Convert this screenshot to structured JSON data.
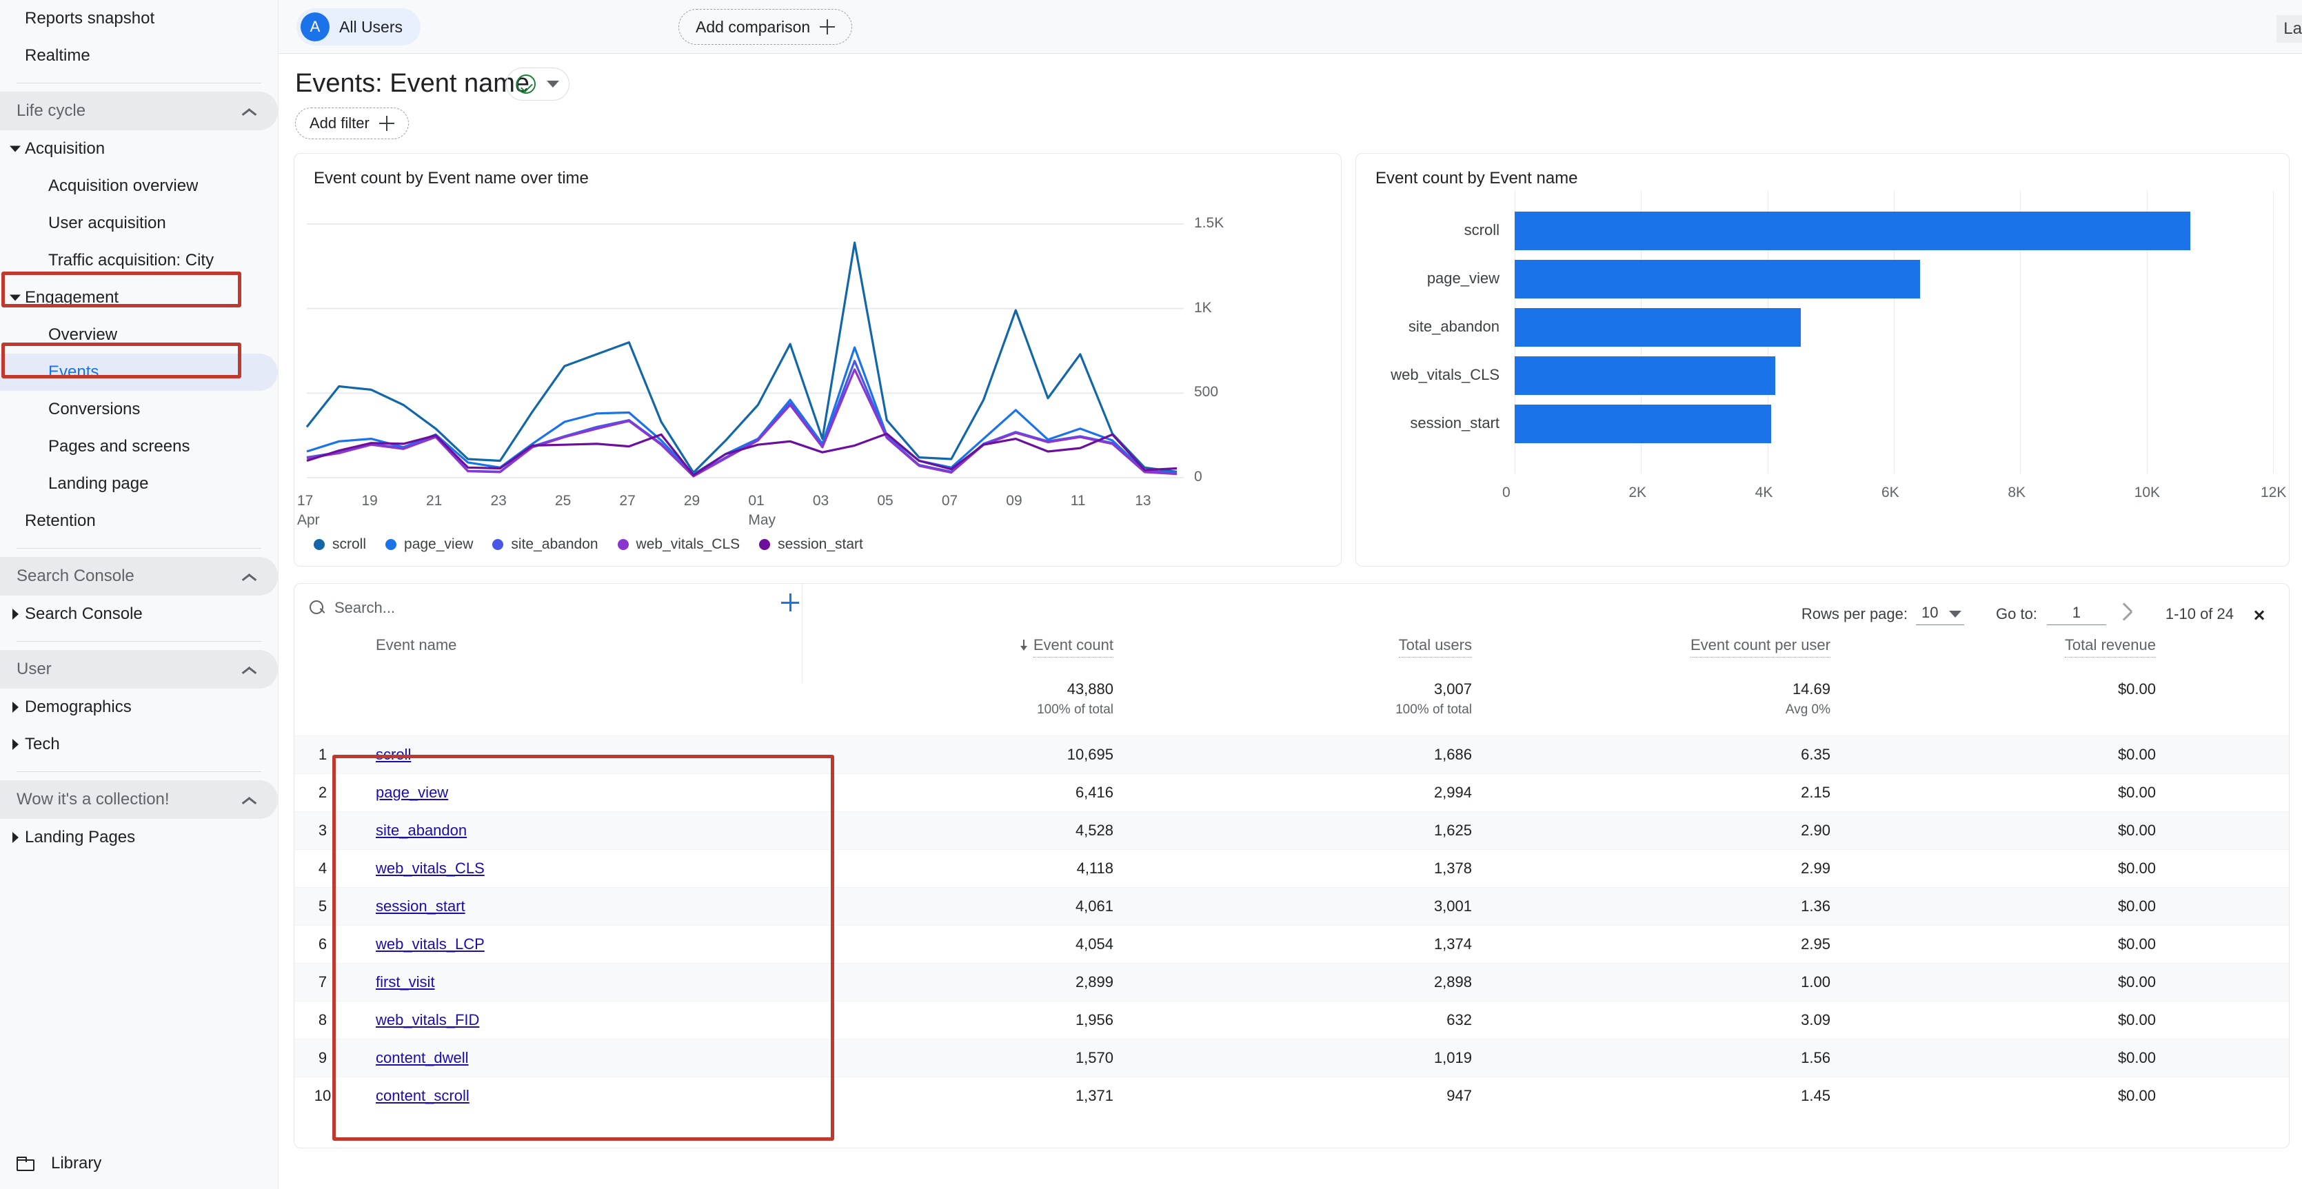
{
  "sidebar": {
    "top_items": [
      {
        "label": "Reports snapshot"
      },
      {
        "label": "Realtime"
      }
    ],
    "sections": [
      {
        "title": "Life cycle",
        "items": [
          {
            "label": "Acquisition",
            "level": 1,
            "caret": "down"
          },
          {
            "label": "Acquisition overview",
            "level": 2
          },
          {
            "label": "User acquisition",
            "level": 2
          },
          {
            "label": "Traffic acquisition: City",
            "level": 2
          },
          {
            "label": "Engagement",
            "level": 1,
            "caret": "down",
            "highlighted": true
          },
          {
            "label": "Overview",
            "level": 2
          },
          {
            "label": "Events",
            "level": 2,
            "selected": true
          },
          {
            "label": "Conversions",
            "level": 2
          },
          {
            "label": "Pages and screens",
            "level": 2
          },
          {
            "label": "Landing page",
            "level": 2
          },
          {
            "label": "Retention",
            "level": 1
          }
        ]
      },
      {
        "title": "Search Console",
        "items": [
          {
            "label": "Search Console",
            "level": 1,
            "caret": "right"
          }
        ]
      },
      {
        "title": "User",
        "items": [
          {
            "label": "Demographics",
            "level": 1,
            "caret": "right"
          },
          {
            "label": "Tech",
            "level": 1,
            "caret": "right"
          }
        ]
      },
      {
        "title": "Wow it's a collection!",
        "items": [
          {
            "label": "Landing Pages",
            "level": 1,
            "caret": "right"
          }
        ]
      }
    ],
    "library_label": "Library",
    "library_icon": "folder-icon"
  },
  "topbar": {
    "audience_initial": "A",
    "audience_label": "All Users",
    "add_comparison_label": "Add comparison",
    "date_range_clipped": "La"
  },
  "header": {
    "title": "Events: Event name",
    "add_filter_label": "Add filter",
    "status_icon": "check-circle-icon"
  },
  "line_card": {
    "title": "Event count by Event name over time"
  },
  "bar_card": {
    "title": "Event count by Event name"
  },
  "table": {
    "search_placeholder": "Search...",
    "rows_per_page_label": "Rows per page:",
    "rows_per_page_value": "10",
    "goto_label": "Go to:",
    "goto_value": "1",
    "page_range": "1-10 of 24",
    "columns": [
      "Event name",
      "Event count",
      "Total users",
      "Event count per user",
      "Total revenue"
    ],
    "sorted_column": "Event count",
    "totals": {
      "event_count": "43,880",
      "event_count_sub": "100% of total",
      "total_users": "3,007",
      "total_users_sub": "100% of total",
      "event_count_per_user": "14.69",
      "event_count_per_user_sub": "Avg 0%",
      "total_revenue": "$0.00",
      "total_revenue_sub": ""
    },
    "rows": [
      {
        "rank": "1",
        "name": "scroll",
        "event_count": "10,695",
        "total_users": "1,686",
        "per_user": "6.35",
        "revenue": "$0.00"
      },
      {
        "rank": "2",
        "name": "page_view",
        "event_count": "6,416",
        "total_users": "2,994",
        "per_user": "2.15",
        "revenue": "$0.00"
      },
      {
        "rank": "3",
        "name": "site_abandon",
        "event_count": "4,528",
        "total_users": "1,625",
        "per_user": "2.90",
        "revenue": "$0.00"
      },
      {
        "rank": "4",
        "name": "web_vitals_CLS",
        "event_count": "4,118",
        "total_users": "1,378",
        "per_user": "2.99",
        "revenue": "$0.00"
      },
      {
        "rank": "5",
        "name": "session_start",
        "event_count": "4,061",
        "total_users": "3,001",
        "per_user": "1.36",
        "revenue": "$0.00"
      },
      {
        "rank": "6",
        "name": "web_vitals_LCP",
        "event_count": "4,054",
        "total_users": "1,374",
        "per_user": "2.95",
        "revenue": "$0.00"
      },
      {
        "rank": "7",
        "name": "first_visit",
        "event_count": "2,899",
        "total_users": "2,898",
        "per_user": "1.00",
        "revenue": "$0.00"
      },
      {
        "rank": "8",
        "name": "web_vitals_FID",
        "event_count": "1,956",
        "total_users": "632",
        "per_user": "3.09",
        "revenue": "$0.00"
      },
      {
        "rank": "9",
        "name": "content_dwell",
        "event_count": "1,570",
        "total_users": "1,019",
        "per_user": "1.56",
        "revenue": "$0.00"
      },
      {
        "rank": "10",
        "name": "content_scroll",
        "event_count": "1,371",
        "total_users": "947",
        "per_user": "1.45",
        "revenue": "$0.00"
      }
    ]
  },
  "colors": {
    "accent_blue": "#1a73e8",
    "link": "#1a0dab",
    "annotation_red": "#c0392f",
    "series": [
      "#1267a8",
      "#1a73e8",
      "#4758e8",
      "#8a36cf",
      "#6b0f9c"
    ]
  },
  "chart_data": [
    {
      "type": "line",
      "title": "Event count by Event name over time",
      "xlabel": "",
      "ylabel": "",
      "ylim": [
        0,
        1500
      ],
      "yticks": [
        "0",
        "500",
        "1K",
        "1.5K"
      ],
      "grid": true,
      "legend_position": "bottom-left",
      "x": [
        "17 Apr",
        "18",
        "19",
        "20",
        "21",
        "22",
        "23",
        "24",
        "25",
        "26",
        "27",
        "28",
        "29",
        "30",
        "01 May",
        "02",
        "03",
        "04",
        "05",
        "06",
        "07",
        "08",
        "09",
        "10",
        "11",
        "12",
        "13",
        "14"
      ],
      "xticks": [
        "17",
        "19",
        "21",
        "23",
        "25",
        "27",
        "29",
        "01",
        "03",
        "05",
        "07",
        "09",
        "11",
        "13"
      ],
      "xtick_sublabels": {
        "17": "Apr",
        "01": "May"
      },
      "series": [
        {
          "name": "scroll",
          "color": "#1267a8",
          "values": [
            300,
            540,
            520,
            430,
            290,
            110,
            100,
            390,
            660,
            730,
            800,
            330,
            30,
            220,
            430,
            790,
            230,
            1390,
            340,
            120,
            110,
            460,
            990,
            470,
            730,
            260,
            60,
            35
          ]
        },
        {
          "name": "page_view",
          "color": "#1a73e8",
          "values": [
            155,
            215,
            230,
            180,
            255,
            90,
            60,
            200,
            330,
            380,
            385,
            220,
            20,
            140,
            230,
            460,
            200,
            770,
            250,
            100,
            60,
            230,
            400,
            225,
            290,
            220,
            40,
            30
          ]
        },
        {
          "name": "site_abandon",
          "color": "#4758e8",
          "values": [
            120,
            150,
            200,
            175,
            245,
            40,
            35,
            185,
            245,
            300,
            340,
            200,
            10,
            120,
            225,
            440,
            185,
            690,
            240,
            75,
            35,
            200,
            270,
            215,
            245,
            205,
            35,
            25
          ]
        },
        {
          "name": "web_vitals_CLS",
          "color": "#8a36cf",
          "values": [
            115,
            145,
            195,
            170,
            240,
            38,
            33,
            180,
            240,
            290,
            335,
            195,
            8,
            115,
            220,
            430,
            180,
            640,
            235,
            70,
            30,
            195,
            265,
            210,
            240,
            200,
            33,
            22
          ]
        },
        {
          "name": "session_start",
          "color": "#6b0f9c",
          "values": [
            100,
            160,
            205,
            200,
            250,
            60,
            55,
            190,
            195,
            200,
            185,
            255,
            15,
            140,
            195,
            215,
            150,
            190,
            260,
            100,
            50,
            195,
            230,
            155,
            175,
            255,
            45,
            55
          ]
        }
      ]
    },
    {
      "type": "bar",
      "orientation": "horizontal",
      "title": "Event count by Event name",
      "xlabel": "",
      "ylabel": "",
      "xlim": [
        0,
        12000
      ],
      "xticks": [
        "0",
        "2K",
        "4K",
        "6K",
        "8K",
        "10K",
        "12K"
      ],
      "grid": true,
      "bar_color": "#1a73e8",
      "categories": [
        "scroll",
        "page_view",
        "site_abandon",
        "web_vitals_CLS",
        "session_start"
      ],
      "values": [
        10695,
        6416,
        4528,
        4118,
        4061
      ]
    }
  ]
}
